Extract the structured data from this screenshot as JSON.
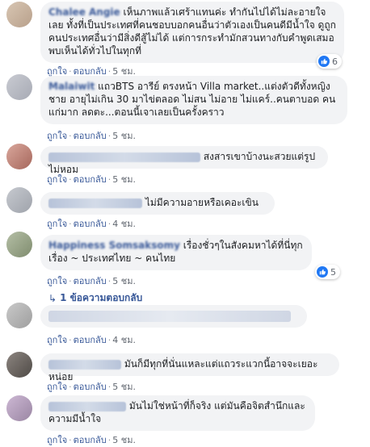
{
  "colors": {
    "link": "#385898",
    "bubble": "#f2f3f5",
    "muted": "#616770",
    "like": "#2078f4"
  },
  "comments": [
    {
      "name": "Chalee Angie",
      "text": "เห็นภาพแล้วเศร้าแทนค่ะ ทำกันไปได้ไม่ละอายใจเลย ทั้งที่เป็นประเทศที่คนชอบบอกคนอื่นว่าตัวเองเป็นคนดีมีน้ำใจ ดูถูกคนประเทศอื่นว่ามีสิ่งดีสู้ไม่ได้ แต่การกระทำมักสวนทางกับคำพูดเสมอ พบเห็นได้ทั่วไปในทุกที่",
      "like": "ถูกใจ",
      "reply": "ตอบกลับ",
      "time": "5 ชม.",
      "reaction_count": "6"
    },
    {
      "name": "Malaiwit",
      "text": "แถวBTS อารีย์ ตรงหน้า Villa market..แต่งตัวดีทั้งหญิงชาย อายุไม่เกิน 30 มาไข่ตลอด ไม่สน ไม่อาย ไม่แคร์..คนตาบอด คนแก่มาก ลดตะ...ตอนนี้เจาเลยเป็นครั้งคราว",
      "like": "ถูกใจ",
      "reply": "ตอบกลับ",
      "time": "5 ชม."
    },
    {
      "name": "",
      "text": "สงสารเขาบ้างนะสวยแต่รูปไม่หอม",
      "like": "ถูกใจ",
      "reply": "ตอบกลับ",
      "time": "5 ชม."
    },
    {
      "name": "",
      "text": "ไม่มีความอายหรือเคอะเขิน",
      "like": "ถูกใจ",
      "reply": "ตอบกลับ",
      "time": "4 ชม."
    },
    {
      "name": "Happiness Somsaksomy",
      "text": "เรื่องชั่วๆในสังคมหาได้ที่นี่ทุกเรื่อง ~ ประเทศไทย ~ คนไทย",
      "like": "ถูกใจ",
      "reply": "ตอบกลับ",
      "time": "5 ชม.",
      "reaction_count": "5",
      "replies_label": "1 ข้อความตอบกลับ"
    },
    {
      "name": "",
      "text": "",
      "like": "ถูกใจ",
      "reply": "ตอบกลับ",
      "time": "4 ชม."
    },
    {
      "name": "",
      "text": "มันก็มีทุกที่นั่นแหละแต่แถวระแวกนี้อาจจะเยอะหน่อย",
      "like": "ถูกใจ",
      "reply": "ตอบกลับ",
      "time": "5 ชม."
    },
    {
      "name": "",
      "text": "มันไม่ใช่หน้าที่ก็จริง แต่มันคือจิตสำนึกและความมีน้ำใจ",
      "like": "ถูกใจ",
      "reply": "ตอบกลับ",
      "time": "5 ชม."
    }
  ]
}
